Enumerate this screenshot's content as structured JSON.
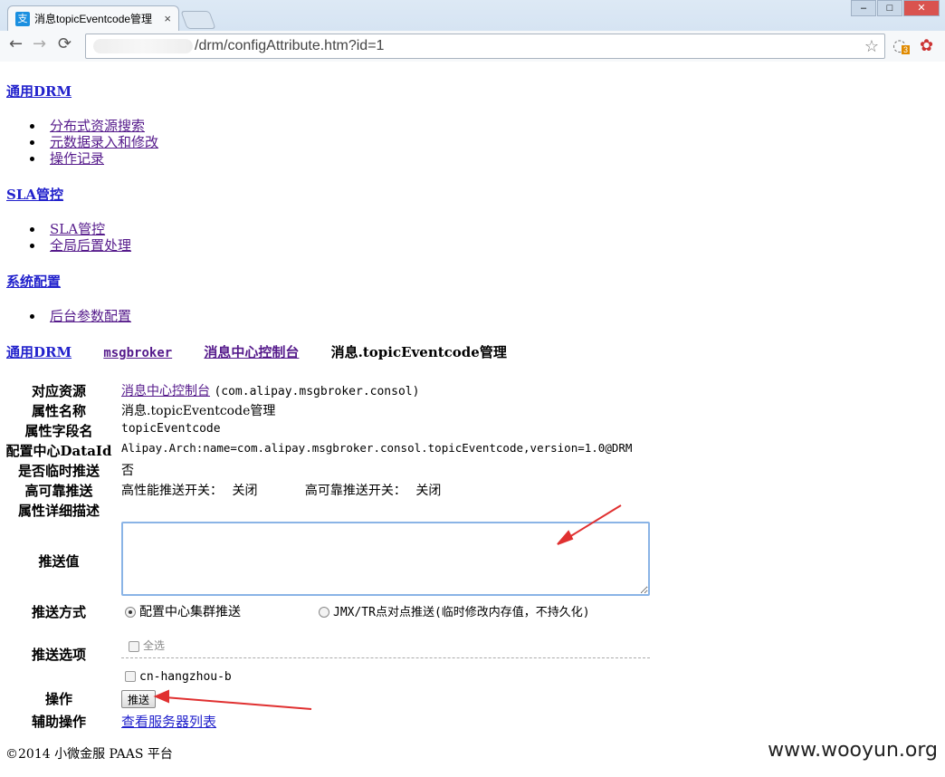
{
  "browser": {
    "tab_title": "消息topicEventcode管理",
    "tab_icon_glyph": "支",
    "url": "/drm/configAttribute.htm?id=1",
    "ext_badge": "3",
    "nav": {
      "back": "←",
      "forward": "→",
      "reload": "⟳",
      "star": "☆",
      "close": "×"
    },
    "window_buttons": {
      "minimize": "–",
      "maximize": "□",
      "close": "✕"
    }
  },
  "sections": [
    {
      "title": "通用DRM",
      "items": [
        "分布式资源搜索",
        "元数据录入和修改",
        "操作记录"
      ]
    },
    {
      "title": "SLA管控",
      "items": [
        "SLA管控",
        "全局后置处理"
      ]
    },
    {
      "title": "系统配置",
      "items": [
        "后台参数配置"
      ]
    }
  ],
  "breadcrumb": [
    "通用DRM",
    "msgbroker",
    "消息中心控制台",
    "消息.topicEventcode管理"
  ],
  "form": {
    "resource_label": "对应资源",
    "resource_link": "消息中心控制台",
    "resource_pkg": "(com.alipay.msgbroker.consol)",
    "attr_name_label": "属性名称",
    "attr_name_value": "消息.topicEventcode管理",
    "field_name_label": "属性字段名",
    "field_name_value": "topicEventcode",
    "dataid_label": "配置中心DataId",
    "dataid_value": "Alipay.Arch:name=com.alipay.msgbroker.consol.topicEventcode,version=1.0@DRM",
    "temp_push_label": "是否临时推送",
    "temp_push_value": "否",
    "reliable_label": "高可靠推送",
    "perf_switch_label": "高性能推送开关：",
    "perf_switch_value": "关闭",
    "reliable_switch_label": "高可靠推送开关：",
    "reliable_switch_value": "关闭",
    "desc_label": "属性详细描述",
    "push_value_label": "推送值",
    "push_value": "",
    "push_mode_label": "推送方式",
    "push_mode_options": [
      "配置中心集群推送",
      "JMX/TR点对点推送(临时修改内存值，不持久化)"
    ],
    "push_mode_selected": "配置中心集群推送",
    "push_options_label": "推送选项",
    "select_all_label": "全选",
    "zone_option": "cn-hangzhou-b",
    "action_label": "操作",
    "push_button": "推送",
    "aux_label": "辅助操作",
    "aux_link": "查看服务器列表"
  },
  "footer": "©2014 小微金服 PAAS 平台",
  "watermark": "www.wooyun.org",
  "colors": {
    "link": "#2222cc",
    "visited": "#551a8b",
    "annotation_arrow": "#e03030"
  }
}
